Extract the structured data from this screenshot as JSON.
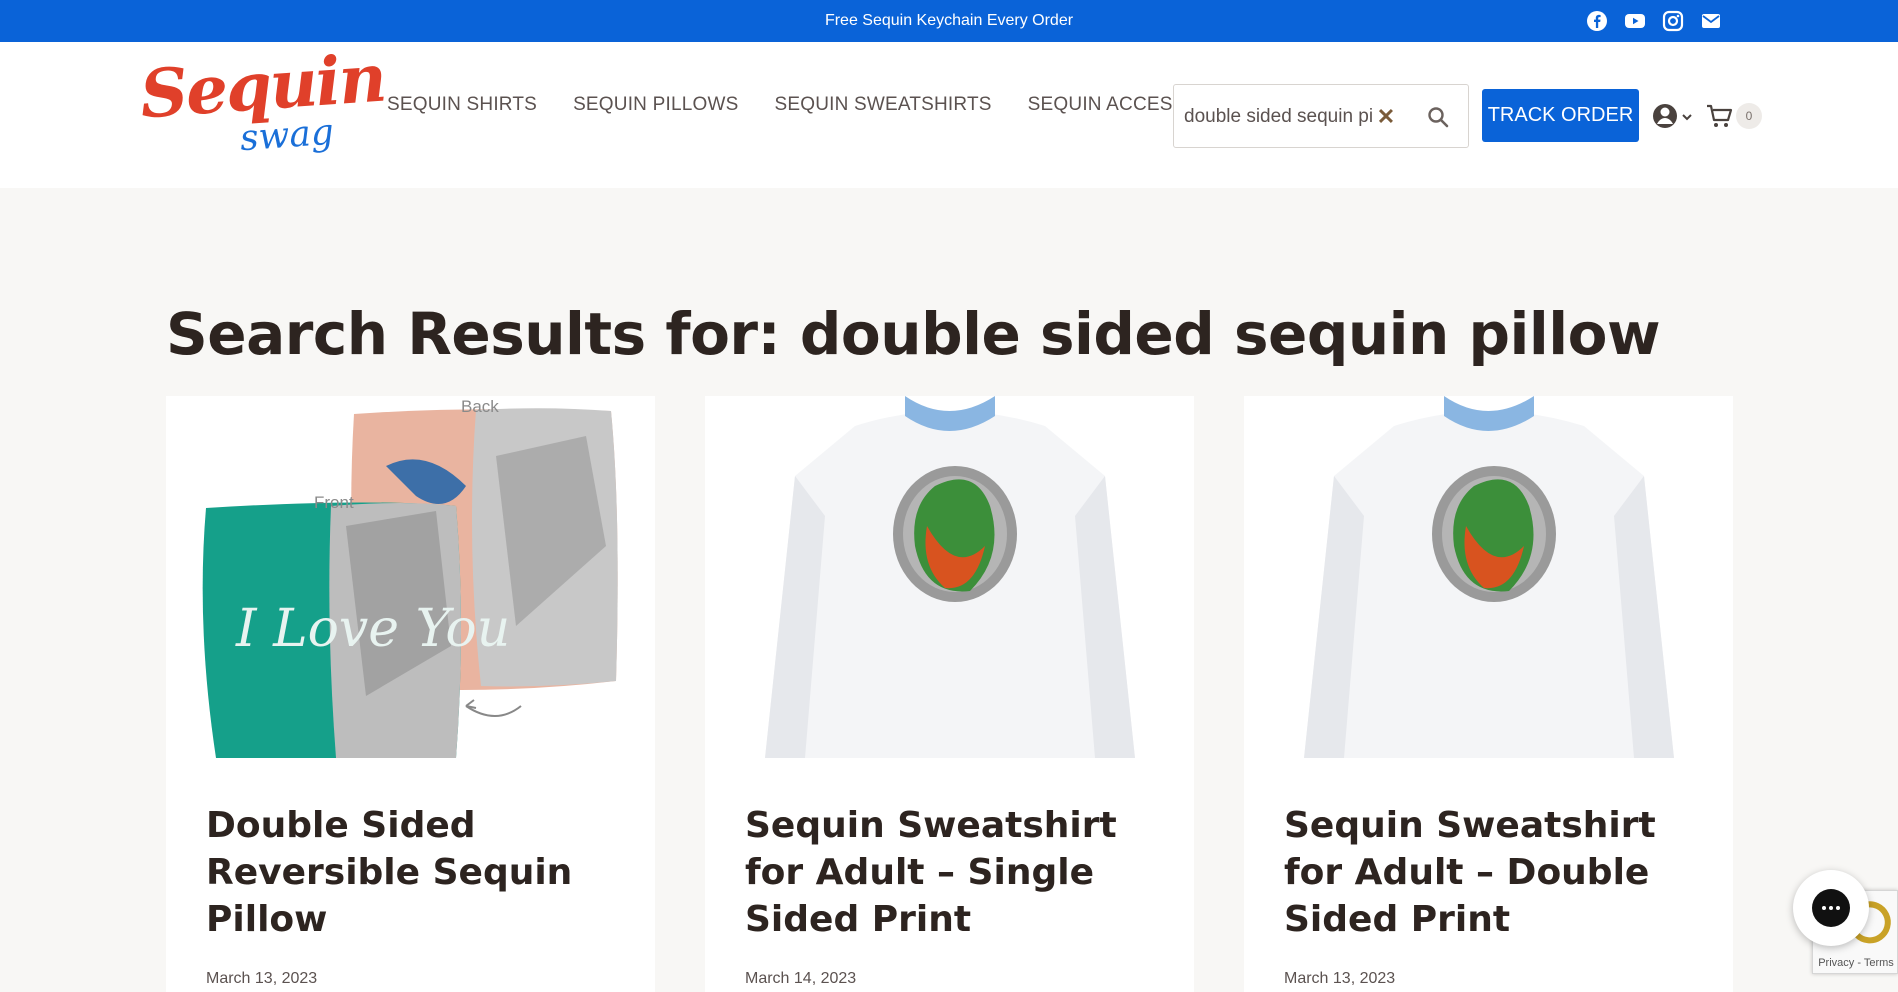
{
  "topbar": {
    "promo": "Free Sequin Keychain Every Order",
    "socials": [
      "facebook-icon",
      "youtube-icon",
      "instagram-icon",
      "email-icon"
    ]
  },
  "header": {
    "logo_main": "Sequin",
    "logo_sub": "swag",
    "nav": [
      "SEQUIN SHIRTS",
      "SEQUIN PILLOWS",
      "SEQUIN SWEATSHIRTS",
      "SEQUIN ACCESSORIES"
    ],
    "search_value": "double sided sequin pillow",
    "track_label": "TRACK ORDER",
    "cart_count": "0"
  },
  "main": {
    "title": "Search Results for: double sided sequin pillow",
    "cards": [
      {
        "title": "Double Sided Reversible Sequin Pillow",
        "date": "March 13, 2023",
        "image": "pillow",
        "label_back": "Back",
        "label_front": "Front",
        "pillow_text": "I Love You"
      },
      {
        "title": "Sequin Sweatshirt for Adult – Single Sided Print",
        "date": "March 14, 2023",
        "image": "sweatshirt"
      },
      {
        "title": "Sequin Sweatshirt for Adult – Double Sided Print",
        "date": "March 13, 2023",
        "image": "sweatshirt"
      }
    ]
  },
  "recaptcha": {
    "text": "Privacy - Terms"
  },
  "colors": {
    "brand_blue": "#0a63d8",
    "logo_red": "#e0402a",
    "heading": "#2d2420"
  }
}
